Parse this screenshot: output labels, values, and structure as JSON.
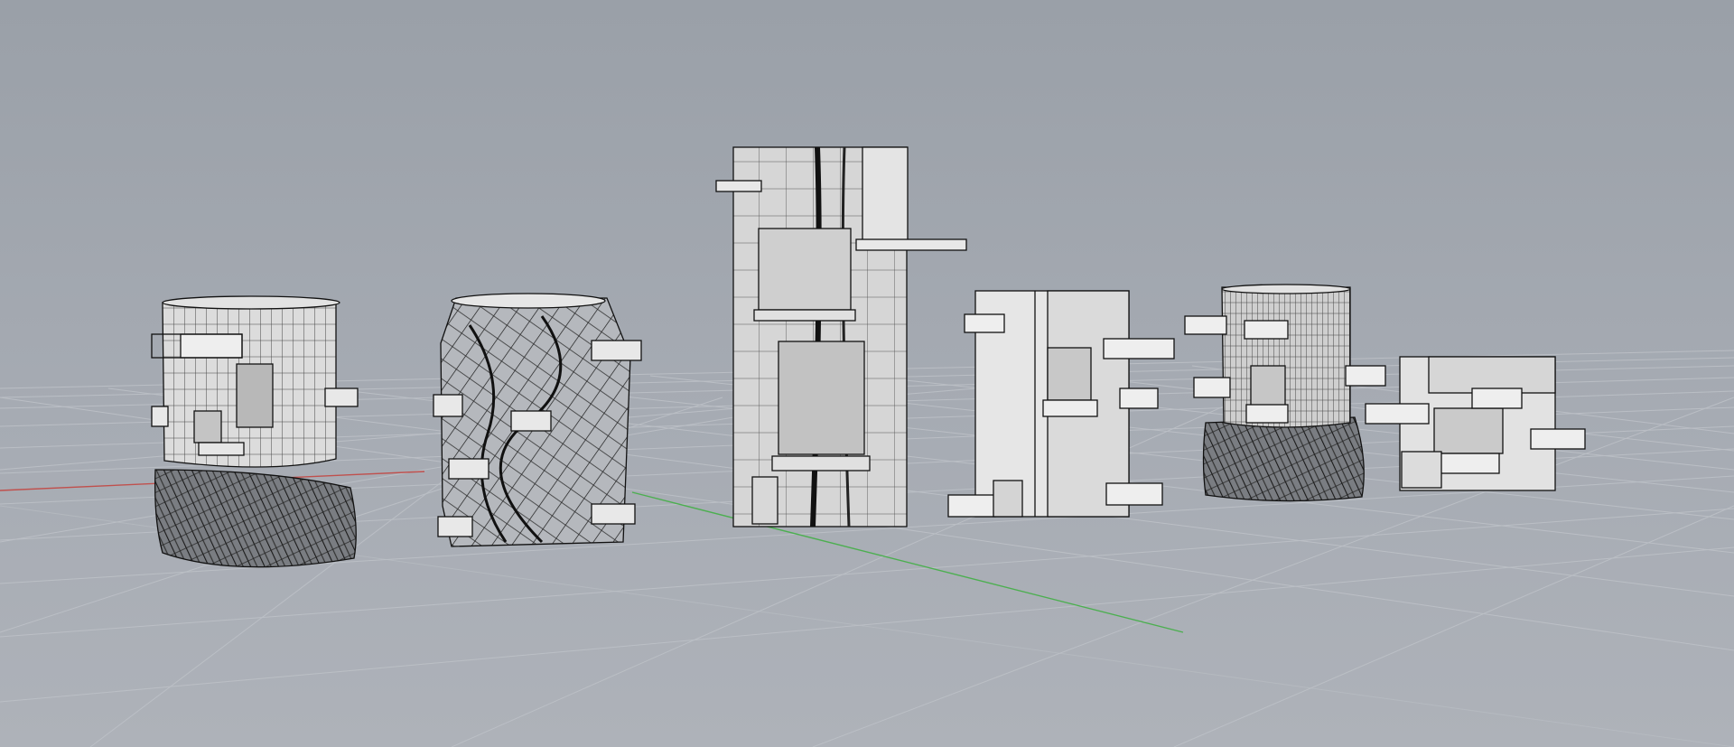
{
  "viewport": {
    "projection": "perspective",
    "display_mode": "shaded-wireframe",
    "background_color": "#a3a8b0",
    "grid_color": "#b8bcc2",
    "x_axis_color": "#c0504d",
    "y_axis_color": "#4caf50"
  },
  "models": [
    {
      "kind": "twisted-base cylinder tower"
    },
    {
      "kind": "fully twisted tower"
    },
    {
      "kind": "tall cylindrical tower"
    },
    {
      "kind": "boxy tower"
    },
    {
      "kind": "small twisted-base tower"
    },
    {
      "kind": "low boxy tower"
    }
  ]
}
